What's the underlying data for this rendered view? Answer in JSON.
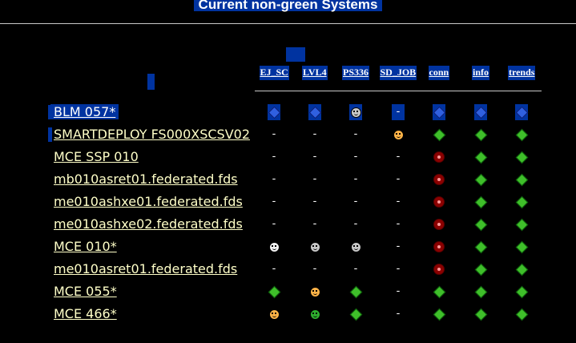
{
  "page": {
    "title": "Current non-green Systems"
  },
  "columns": [
    "EJ_SC",
    "LVL4",
    "PS336",
    "SD_JOB",
    "conn",
    "info",
    "trends"
  ],
  "rows": [
    {
      "host": "BLM 057*",
      "selected": true,
      "cells": [
        "diamond-blue-icon",
        "diamond-blue-icon",
        "smiley-blue-icon",
        "-",
        "diamond-blue-icon",
        "diamond-blue-icon",
        "diamond-blue-icon"
      ]
    },
    {
      "host": "SMARTDEPLOY FS000XSCSV02",
      "selected": false,
      "cells": [
        "-",
        "-",
        "-",
        "smiley-orange-icon",
        "diamond-green-icon",
        "diamond-green-icon",
        "diamond-green-icon"
      ]
    },
    {
      "host": "MCE SSP 010",
      "selected": false,
      "cells": [
        "-",
        "-",
        "-",
        "-",
        "red-circle-icon",
        "diamond-green-icon",
        "diamond-green-icon"
      ]
    },
    {
      "host": "mb010asret01.federated.fds",
      "selected": false,
      "cells": [
        "-",
        "-",
        "-",
        "-",
        "red-circle-icon",
        "diamond-green-icon",
        "diamond-green-icon"
      ]
    },
    {
      "host": "me010ashxe01.federated.fds",
      "selected": false,
      "cells": [
        "-",
        "-",
        "-",
        "-",
        "red-circle-icon",
        "diamond-green-icon",
        "diamond-green-icon"
      ]
    },
    {
      "host": "me010ashxe02.federated.fds",
      "selected": false,
      "cells": [
        "-",
        "-",
        "-",
        "-",
        "red-circle-icon",
        "diamond-green-icon",
        "diamond-green-icon"
      ]
    },
    {
      "host": "MCE 010*",
      "selected": false,
      "cells": [
        "smiley-white-icon",
        "smiley-grey-icon",
        "smiley-grey-icon",
        "-",
        "red-circle-icon",
        "diamond-green-icon",
        "diamond-green-icon"
      ]
    },
    {
      "host": "me010asret01.federated.fds",
      "selected": false,
      "cells": [
        "-",
        "-",
        "-",
        "-",
        "red-circle-icon",
        "diamond-green-icon",
        "diamond-green-icon"
      ]
    },
    {
      "host": "MCE 055*",
      "selected": false,
      "cells": [
        "diamond-green-icon",
        "smiley-orange-icon",
        "diamond-green-icon",
        "-",
        "diamond-green-icon",
        "diamond-green-icon",
        "diamond-green-icon"
      ]
    },
    {
      "host": "MCE 466*",
      "selected": false,
      "cells": [
        "smiley-orange-icon",
        "smiley-green-icon",
        "diamond-green-icon",
        "-",
        "diamond-green-icon",
        "diamond-green-icon",
        "diamond-green-icon"
      ]
    }
  ]
}
